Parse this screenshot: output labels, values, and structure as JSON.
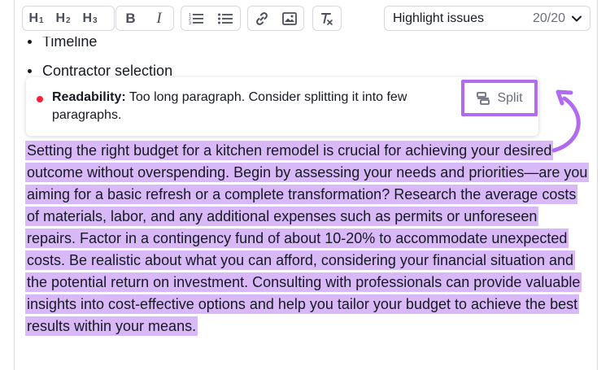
{
  "toolbar": {
    "h1": "H",
    "h1_sub": "1",
    "h2": "H",
    "h2_sub": "2",
    "h3": "H",
    "h3_sub": "3",
    "bold": "B",
    "italic": "I",
    "highlight_label": "Highlight issues",
    "highlight_count": "20/20"
  },
  "bullets": [
    "Timeline",
    "Contractor selection"
  ],
  "issue": {
    "category": "Readability:",
    "message": "Too long paragraph. Consider splitting it into few paragraphs.",
    "action_label": "Split"
  },
  "paragraph": "Setting the right budget for a kitchen remodel is crucial for achieving your desired outcome without overspending. Begin by assessing your needs and priorities—are you aiming for a basic refresh or a complete transformation? Research the average costs of materials, labor, and any additional expenses such as permits or unforeseen repairs. Factor in a contingency fund of about 10-20% to accommodate unexpected costs. Be realistic about what you can afford, considering your financial situation and the potential return on investment. Consulting with professionals can provide valuable insights into cost-effective options and help you tailor your budget to achieve the best results within your means.",
  "colors": {
    "highlight": "#d9b8f7",
    "accent": "#b26bf0",
    "issue_dot": "#ff1e3c"
  }
}
